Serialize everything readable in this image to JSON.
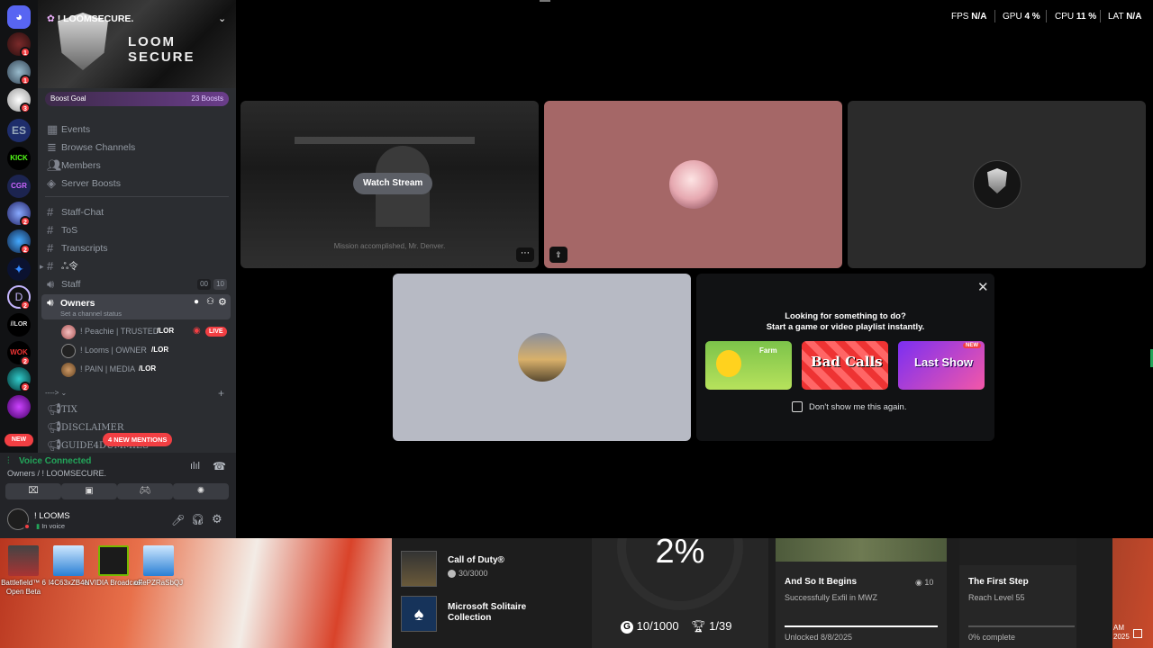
{
  "server": {
    "name": "! LOOMSECURE.",
    "banner_text": "LOOM SECURE",
    "boost_goal": "Boost Goal",
    "boosts": "23 Boosts"
  },
  "guild_badges": [
    "1",
    "1",
    "3",
    "2",
    "2",
    "2",
    "2",
    "2",
    "1"
  ],
  "guild_labels": {
    "es": "ES",
    "kick": "KICK",
    "cgr": "CGR",
    "lor": "//LOR",
    "wok": "WOK",
    "new": "NEW"
  },
  "nav_items": [
    "Events",
    "Browse Channels",
    "Members",
    "Server Boosts"
  ],
  "channels": {
    "staff_chat": "Staff-Chat",
    "tos": "ToS",
    "transcripts": "Transcripts",
    "symbols": "ஃ令",
    "staff": "Staff",
    "staff_count_a": "00",
    "staff_count_b": "10",
    "owners": "Owners",
    "owners_status": "Set a channel status",
    "category": "---->",
    "tix": "TIX",
    "disclaimer": "DISCLAIMER",
    "guide": "GUIDE4DUMMIES",
    "mentions_pill": "4 NEW MENTIONS"
  },
  "voice_users": [
    {
      "name": "! Peachie | TRUSTED",
      "tag": "/LOR",
      "live": "LIVE"
    },
    {
      "name": "! Looms | OWNER",
      "tag": "/LOR"
    },
    {
      "name": "! PAIN | MEDIA",
      "tag": "/LOR"
    }
  ],
  "voice_panel": {
    "status": "Voice Connected",
    "location": "Owners / ! LOOMSECURE."
  },
  "user_panel": {
    "username": "! LOOMS",
    "status": "In voice"
  },
  "stats": {
    "fps_label": "FPS",
    "fps_value": "N/A",
    "gpu_label": "GPU",
    "gpu_value": "4 %",
    "cpu_label": "CPU",
    "cpu_value": "11 %",
    "lat_label": "LAT",
    "lat_value": "N/A"
  },
  "stream": {
    "watch_label": "Watch Stream",
    "caption": "Mission accomplished, Mr. Denver."
  },
  "activity": {
    "title": "Looking for something to do?",
    "subtitle": "Start a game or video playlist instantly.",
    "dont_show": "Don't show me this again.",
    "games": [
      "Farm",
      "Bad Calls",
      "Last Show"
    ],
    "new_tag": "NEW"
  },
  "desktop_icons": [
    {
      "label": "Battlefield™ 6 Open Beta"
    },
    {
      "label": "l4C63xZB4e"
    },
    {
      "label": "NVIDIA Broadcast"
    },
    {
      "label": "oFePZRaSbQJ"
    }
  ],
  "xbox": {
    "games": [
      {
        "title": "Call of Duty®",
        "score": "30/3000"
      },
      {
        "title": "Microsoft Solitaire Collection"
      }
    ],
    "percent": "2%",
    "gamerscore": "10/1000",
    "trophies": "1/39",
    "achievement1": {
      "title": "And So It Begins",
      "desc": "Successfully Exfil in MWZ",
      "points": "10",
      "unlocked": "Unlocked 8/8/2025"
    },
    "achievement2": {
      "title": "The First Step",
      "desc": "Reach Level 55",
      "progress": "0% complete"
    },
    "clock": [
      "AM",
      "2025"
    ]
  },
  "colors": {
    "accent": "#5865f2",
    "live": "#f23f43",
    "green": "#23a55a"
  }
}
